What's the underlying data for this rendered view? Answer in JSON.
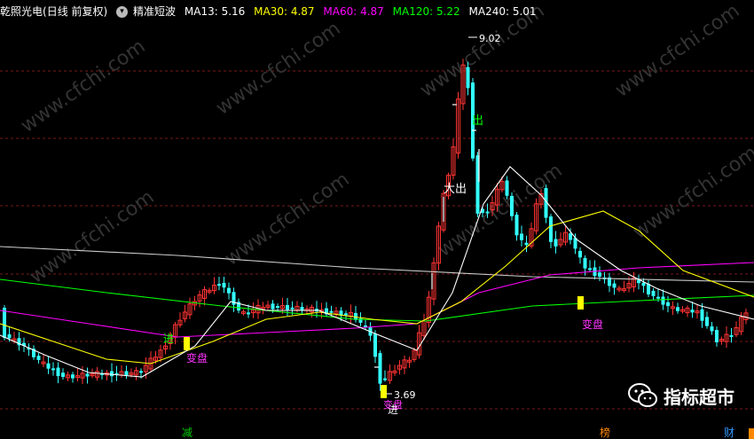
{
  "header": {
    "stock_name": "乾照光电",
    "period": "(日线 前复权)",
    "indicator_name": "精准短波",
    "ma": [
      {
        "label": "MA13: 5.16",
        "color": "#ffffff"
      },
      {
        "label": "MA30: 4.87",
        "color": "#ffff00"
      },
      {
        "label": "MA60: 4.87",
        "color": "#ff00ff"
      },
      {
        "label": "MA120: 5.22",
        "color": "#00ff00"
      },
      {
        "label": "MA240: 5.01",
        "color": "#ffffff"
      }
    ]
  },
  "annotations": {
    "high_price": "9.02",
    "low_price": "3.69",
    "big_out": "大出",
    "out": "出",
    "in1": "进",
    "in2": "进",
    "change1": "变盘",
    "change2": "变盘",
    "change3": "变盘"
  },
  "bottom_labels": [
    {
      "text": "减",
      "color": "#00cc00"
    },
    {
      "text": "榜",
      "color": "#ff8800"
    },
    {
      "text": "财",
      "color": "#3399ff"
    }
  ],
  "watermark": {
    "text": "指标超市",
    "site": "www.cfchi.com"
  },
  "colors": {
    "up": "#ff3333",
    "down": "#33ffff",
    "ma13": "#ffffff",
    "ma30": "#ffff00",
    "ma60": "#ff00ff",
    "ma120": "#00ff00",
    "ma240": "#cccccc",
    "signal_green": "#00ff00",
    "signal_magenta": "#ff33ff",
    "marker": "#ffff00"
  }
}
